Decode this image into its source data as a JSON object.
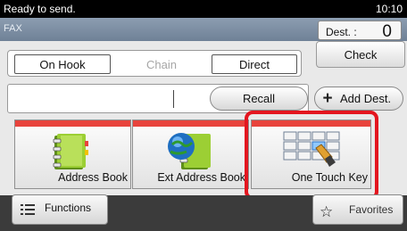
{
  "status": {
    "message": "Ready to send.",
    "time": "10:10"
  },
  "title": "FAX",
  "dest": {
    "label": "Dest. :",
    "count": "0"
  },
  "line_mode": {
    "on_hook": "On Hook",
    "chain": "Chain",
    "direct": "Direct"
  },
  "check_label": "Check",
  "recall_label": "Recall",
  "add_dest_label": "Add Dest.",
  "tiles": [
    {
      "label": "Address Book"
    },
    {
      "label": "Ext Address Book"
    },
    {
      "label": "One Touch Key"
    }
  ],
  "functions_label": "Functions",
  "favorites_label": "Favorites",
  "colors": {
    "accent_red": "#e8433c",
    "highlight_red": "#e3161f"
  }
}
